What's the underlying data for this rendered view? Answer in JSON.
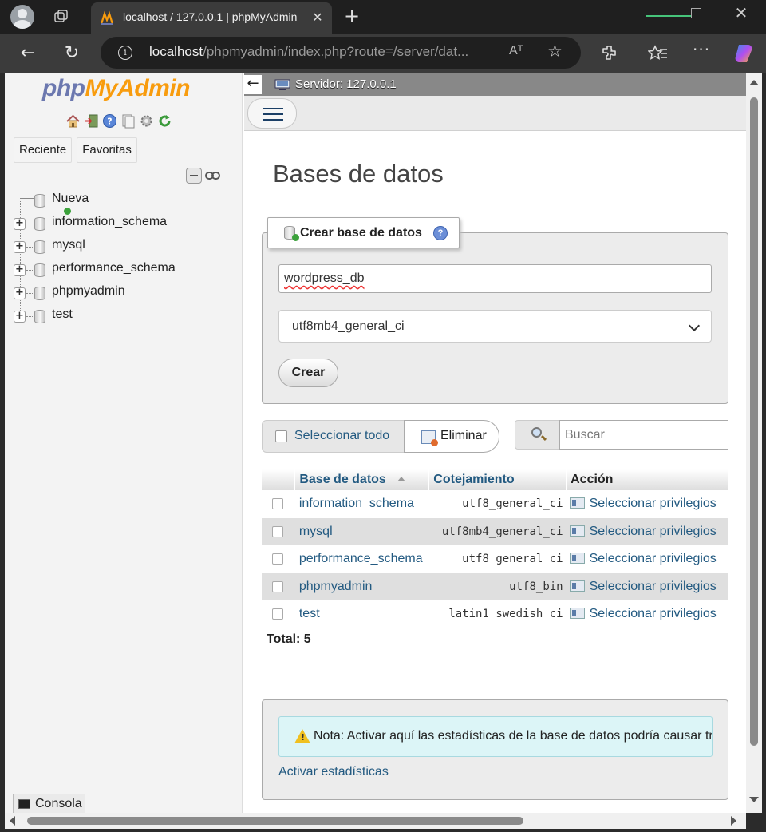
{
  "browser": {
    "tab_title": "localhost / 127.0.0.1 | phpMyAdmin",
    "tab_close": "✕",
    "new_tab": "+",
    "url_host": "localhost",
    "url_path": "/phpmyadmin/index.php?route=/server/dat...",
    "read_aloud": "Aᵀ",
    "favorite_glyph": "☆",
    "more_glyph": "···",
    "close_glyph": "✕",
    "back_glyph": "←",
    "reload_glyph": "↻"
  },
  "sidebar": {
    "logo_php": "php",
    "logo_myadmin": "MyAdmin",
    "buttons": [
      "Reciente",
      "Favoritas"
    ],
    "tree": {
      "new_label": "Nueva",
      "expander": "+",
      "databases": [
        "information_schema",
        "mysql",
        "performance_schema",
        "phpmyadmin",
        "test"
      ]
    }
  },
  "topbar": {
    "back": "←",
    "server": "Servidor: 127.0.0.1"
  },
  "main": {
    "heading": "Bases de datos",
    "create": {
      "legend": "Crear base de datos",
      "help": "?",
      "db_name_value": "wordpress_db",
      "collation_value": "utf8mb4_general_ci",
      "create_button": "Crear"
    },
    "toolbar": {
      "select_all": "Seleccionar todo",
      "delete": "Eliminar",
      "search_placeholder": "Buscar"
    },
    "table": {
      "headers": {
        "database": "Base de datos",
        "collation": "Cotejamiento",
        "action": "Acción"
      },
      "rows": [
        {
          "name": "information_schema",
          "collation": "utf8_general_ci",
          "action": "Seleccionar privilegios"
        },
        {
          "name": "mysql",
          "collation": "utf8mb4_general_ci",
          "action": "Seleccionar privilegios"
        },
        {
          "name": "performance_schema",
          "collation": "utf8_general_ci",
          "action": "Seleccionar privilegios"
        },
        {
          "name": "phpmyadmin",
          "collation": "utf8_bin",
          "action": "Seleccionar privilegios"
        },
        {
          "name": "test",
          "collation": "latin1_swedish_ci",
          "action": "Seleccionar privilegios"
        }
      ],
      "total": "Total: 5"
    },
    "stats": {
      "notice": "Nota: Activar aquí las estadísticas de la base de datos podría causar tráfico",
      "activate_link": "Activar estadísticas"
    },
    "console": "Consola"
  },
  "colors": {
    "link": "#235a81",
    "logo_php": "#6c78af",
    "logo_myadmin": "#f89c0e",
    "notice_bg": "#dcf5f7"
  }
}
